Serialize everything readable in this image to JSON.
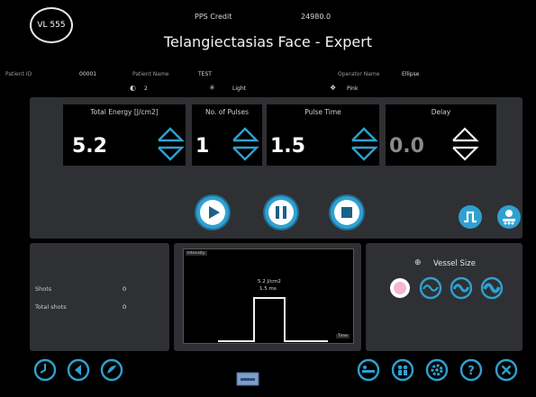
{
  "header": {
    "logo": "VL 555",
    "credit_label": "PPS Credit",
    "credit_value": "24980.0",
    "title": "Telangiectasias Face - Expert",
    "patient_id_label": "Patient ID",
    "patient_id": "00001",
    "patient_name_label": "Patient Name",
    "patient_name": "TEST",
    "operator_label": "Operator Name",
    "operator_name": "Ellipse",
    "skin_type": "2",
    "skin_tone": "Light",
    "skin_color": "Pink"
  },
  "params": [
    {
      "label": "Total Energy [J/cm2]",
      "value": "5.2"
    },
    {
      "label": "No. of Pulses",
      "value": "1"
    },
    {
      "label": "Pulse Time",
      "value": "1.5"
    },
    {
      "label": "Delay",
      "value": "0.0"
    }
  ],
  "stats": {
    "shots_label": "Shots",
    "shots_value": "0",
    "total_label": "Total shots",
    "total_value": "0"
  },
  "pulse_graph": {
    "y_label": "Intensity",
    "x_label": "Time",
    "energy": "5.2 J/cm2",
    "duration": "1.5 ms"
  },
  "vessel": {
    "title": "Vessel Size",
    "selected_index": 0
  },
  "colors": {
    "accent": "#2ea1d0",
    "panel": "#2f3033",
    "disabled": "#8a8a8a",
    "selected_vessel": "#f3b7d2"
  },
  "icons": [
    "play-icon",
    "pause-icon",
    "stop-icon",
    "pulse-shape-icon",
    "handpiece-icon",
    "clock-icon",
    "back-icon",
    "paint-icon",
    "keyboard-icon",
    "bed-icon",
    "people-icon",
    "settings-icon",
    "help-icon",
    "close-icon"
  ]
}
